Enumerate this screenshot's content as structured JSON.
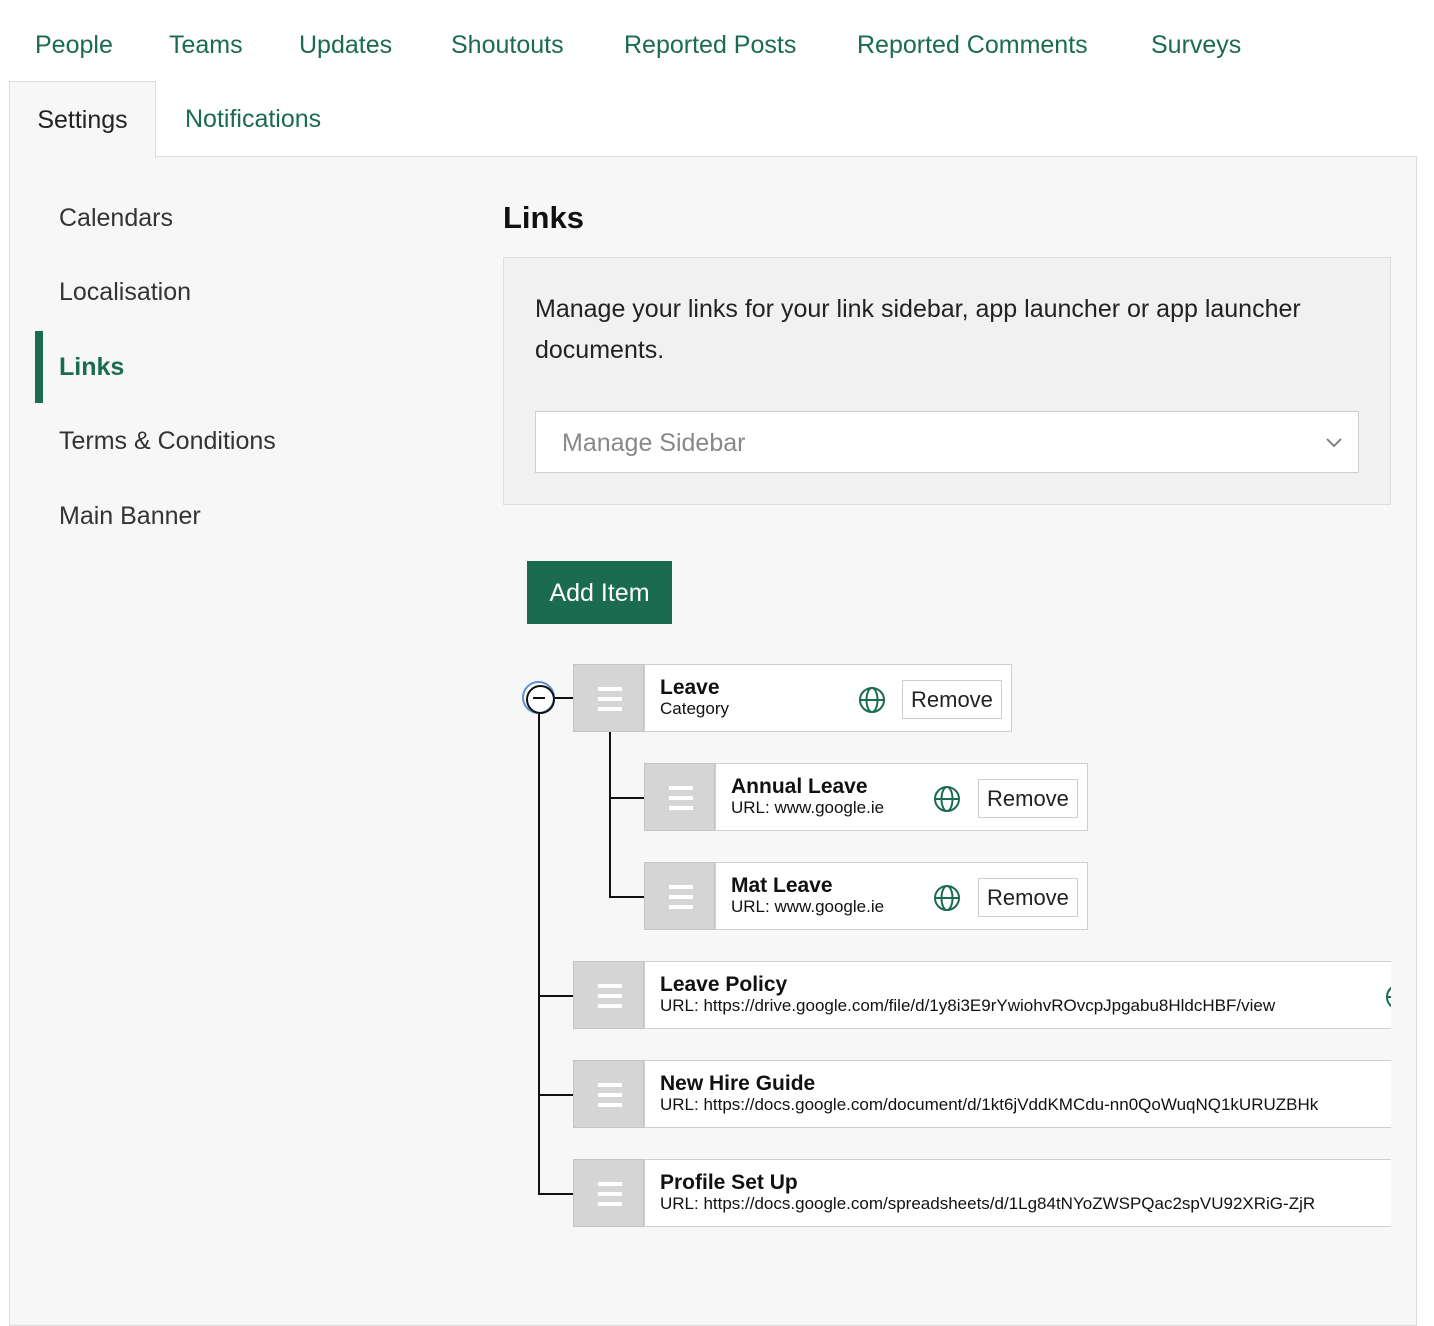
{
  "top_nav": {
    "items": [
      "People",
      "Teams",
      "Updates",
      "Shoutouts",
      "Reported Posts",
      "Reported Comments",
      "Surveys"
    ]
  },
  "sub_tabs": {
    "settings": "Settings",
    "notifications": "Notifications"
  },
  "sidebar": {
    "items": [
      "Calendars",
      "Localisation",
      "Links",
      "Terms & Conditions",
      "Main Banner"
    ],
    "active": "Links"
  },
  "main": {
    "title": "Links",
    "description": "Manage your links for your link sidebar, app launcher or app launcher documents.",
    "select_value": "Manage Sidebar",
    "add_button": "Add Item"
  },
  "tree": {
    "remove_label": "Remove",
    "nodes": [
      {
        "title": "Leave",
        "subtitle": "Category"
      },
      {
        "title": "Annual Leave",
        "subtitle": "URL: www.google.ie"
      },
      {
        "title": "Mat Leave",
        "subtitle": "URL: www.google.ie"
      },
      {
        "title": "Leave Policy",
        "subtitle": "URL: https://drive.google.com/file/d/1y8i3E9rYwiohvROvcpJpgabu8HldcHBF/view"
      },
      {
        "title": "New Hire Guide",
        "subtitle": "URL: https://docs.google.com/document/d/1kt6jVddKMCdu-nn0QoWuqNQ1kURUZBHk"
      },
      {
        "title": "Profile Set Up",
        "subtitle": "URL: https://docs.google.com/spreadsheets/d/1Lg84tNYoZWSPQac2spVU92XRiG-ZjR"
      }
    ]
  },
  "colors": {
    "accent": "#1a6b4f",
    "panel_bg": "#f7f7f7",
    "handle_bg": "#d5d5d5"
  },
  "icons": [
    "globe-icon",
    "drag-handle-icon",
    "collapse-icon",
    "chevron-down-icon"
  ]
}
